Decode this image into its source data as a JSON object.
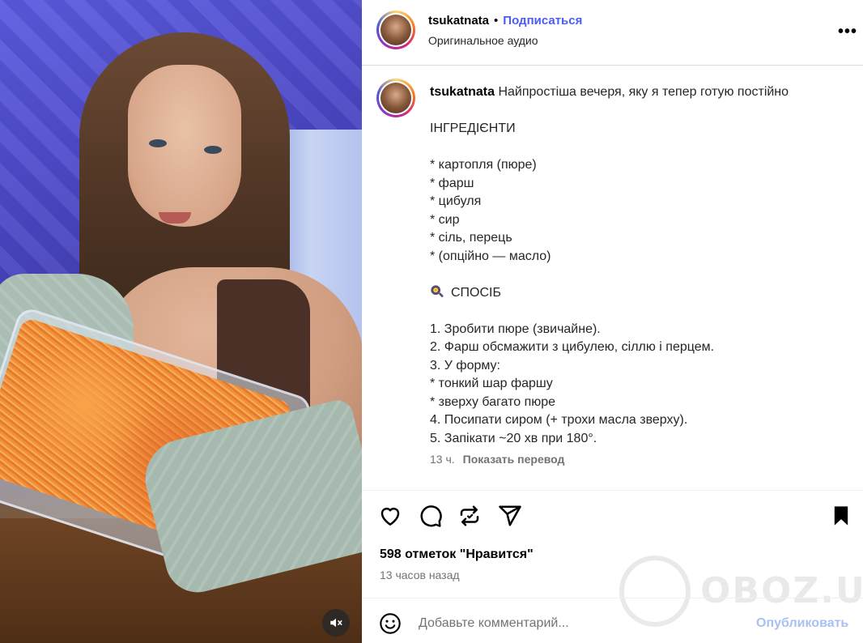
{
  "post": {
    "author": "tsukatnata",
    "separator": "•",
    "follow_label": "Подписаться",
    "audio_label": "Оригинальное аудио",
    "more_label": "•••"
  },
  "caption": {
    "author": "tsukatnata",
    "title": " Найпростіша вечеря, яку я тепер готую постійно",
    "lines": [
      "",
      "ІНГРЕДІЄНТИ",
      "",
      "* картопля (пюре)",
      "* фарш",
      "* цибуля",
      "* сир",
      "* сіль, перець",
      "* (опційно — масло)",
      ""
    ],
    "method_heading": "СПОСІБ",
    "method_lines": [
      "",
      "1. Зробити пюре (звичайне).",
      "2. Фарш обсмажити з цибулею, сіллю і перцем.",
      "3. У форму:",
      "* тонкий шар фаршу",
      "* зверху багато пюре",
      "4. Посипати сиром (+ трохи масла зверху).",
      "5. Запікати ~20 хв при 180°."
    ],
    "age": "13 ч.",
    "translate_label": "Показать перевод"
  },
  "stats": {
    "likes": "598 отметок \"Нравится\"",
    "time": "13 часов назад"
  },
  "comment": {
    "placeholder": "Добавьте комментарий...",
    "publish_label": "Опубликовать"
  },
  "watermark": {
    "text": "OBOZ.UA"
  },
  "icons": {
    "like": "heart-icon",
    "comment": "comment-icon",
    "repost": "repost-icon",
    "share": "share-icon",
    "save": "bookmark-icon",
    "mute": "muted-speaker-icon",
    "emoji": "smiley-icon"
  },
  "colors": {
    "follow_link": "#4a5df9",
    "publish_disabled": "#a8c1f5",
    "muted_text": "#737373"
  }
}
